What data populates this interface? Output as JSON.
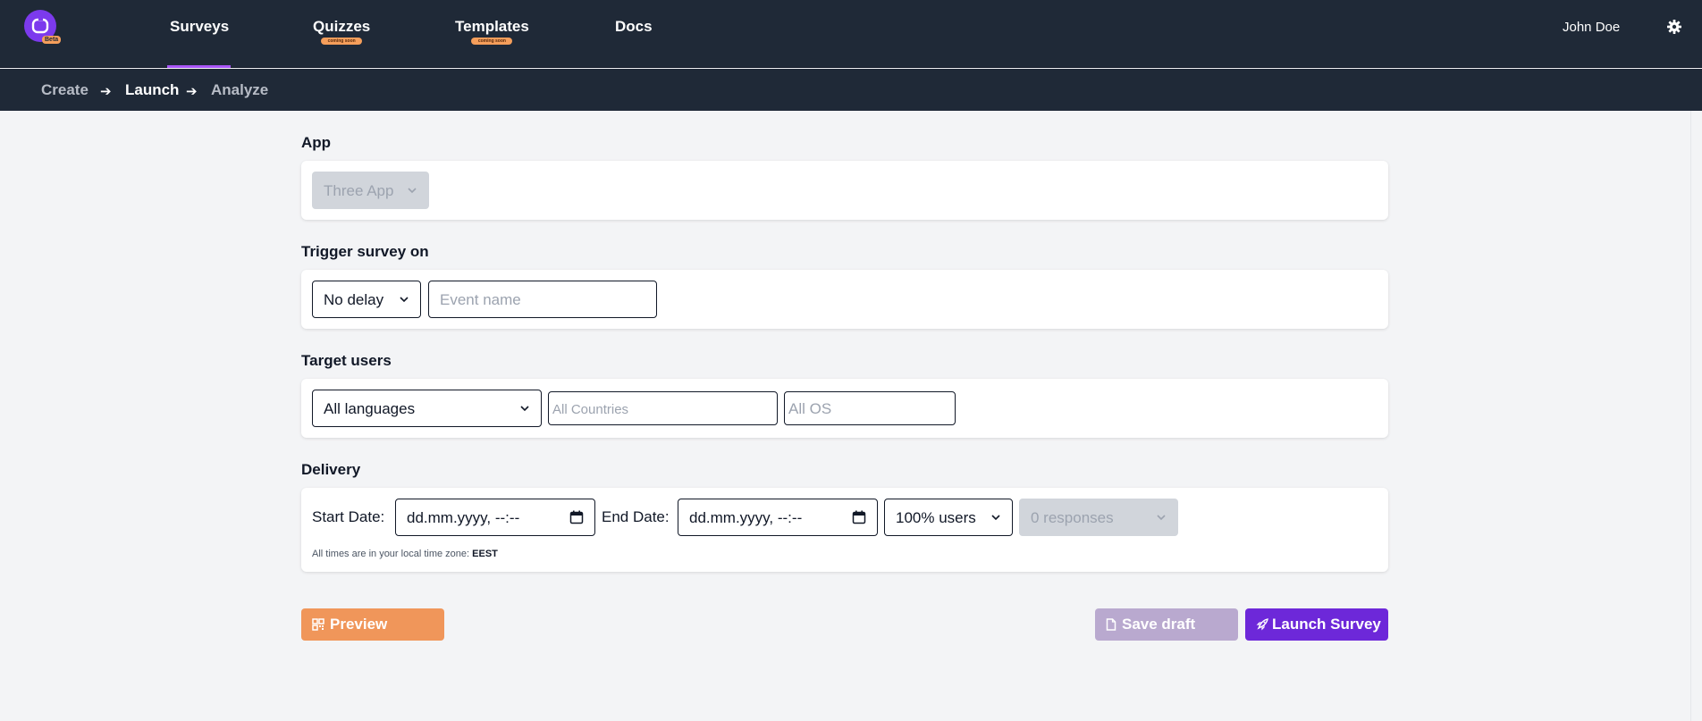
{
  "header": {
    "beta_badge": "Beta",
    "nav": [
      {
        "label": "Surveys",
        "badge": ""
      },
      {
        "label": "Quizzes",
        "badge": "coming soon"
      },
      {
        "label": "Templates",
        "badge": "coming soon"
      },
      {
        "label": "Docs",
        "badge": ""
      }
    ],
    "user_name": "John Doe"
  },
  "breadcrumb": {
    "steps": [
      "Create",
      "Launch",
      "Analyze"
    ],
    "active": "Launch"
  },
  "app_section": {
    "title": "App",
    "app_select_value": "Three App"
  },
  "trigger_section": {
    "title": "Trigger survey on",
    "delay_value": "No delay",
    "event_placeholder": "Event name"
  },
  "target_section": {
    "title": "Target users",
    "language_value": "All languages",
    "countries_placeholder": "All Countries",
    "os_placeholder": "All OS"
  },
  "delivery_section": {
    "title": "Delivery",
    "start_label": "Start Date:",
    "start_value": "dd.mm.yyyy, --:--",
    "end_label": "End Date:",
    "end_value": "dd.mm.yyyy, --:--",
    "users_value": "100% users",
    "responses_value": "0 responses",
    "timezone_hint": "All times are in your local time zone:",
    "timezone": "EEST"
  },
  "actions": {
    "preview_label": "Preview",
    "save_draft_label": "Save draft",
    "launch_label": "Launch Survey"
  },
  "colors": {
    "header_bg": "#1f2937",
    "accent_purple": "#7c3aed",
    "preview_orange": "#f0965a",
    "save_draft_disabled": "#b9a9cf",
    "launch_purple": "#6d28d9"
  }
}
